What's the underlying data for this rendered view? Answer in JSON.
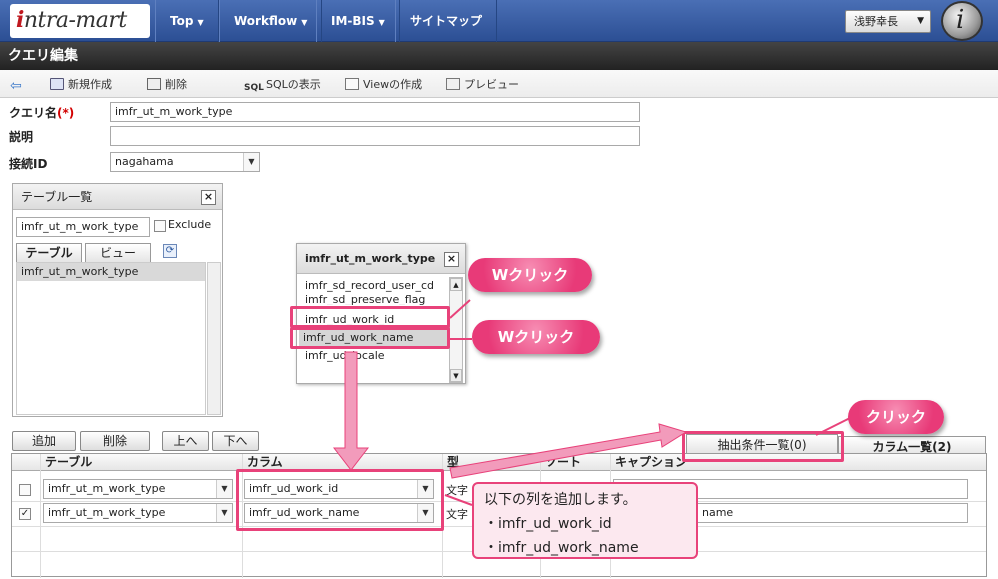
{
  "brand": {
    "logo_text": "intra-mart"
  },
  "nav": {
    "items": [
      {
        "label": "Top"
      },
      {
        "label": "Workflow"
      },
      {
        "label": "IM-BIS"
      },
      {
        "label": "サイトマップ"
      }
    ],
    "user": "浅野幸長"
  },
  "page": {
    "title": "クエリ編集"
  },
  "toolbar": {
    "new_label": "新規作成",
    "delete_label": "削除",
    "sql_prefix": "SQL",
    "sql_label": "SQLの表示",
    "view_label": "Viewの作成",
    "preview_label": "プレビュー"
  },
  "form": {
    "query_name_label": "クエリ名",
    "required_mark": "(*)",
    "query_name_value": "imfr_ut_m_work_type",
    "description_label": "説明",
    "description_value": "",
    "connection_label": "接続ID",
    "connection_value": "nagahama"
  },
  "table_list": {
    "title": "テーブル一覧",
    "filter_value": "imfr_ut_m_work_type",
    "exclude_label": "Exclude",
    "tab_table": "テーブル",
    "tab_view": "ビュー",
    "items": [
      "imfr_ut_m_work_type"
    ]
  },
  "column_popup": {
    "title": "imfr_ut_m_work_type",
    "items": [
      "imfr_sd_record_user_cd",
      "imfr_sd_preserve_flag",
      "imfr_ud_work_id",
      "imfr_ud_work_name",
      "imfr_ud_locale"
    ]
  },
  "buttons": {
    "add": "追加",
    "delete": "削除",
    "up": "上へ",
    "down": "下へ"
  },
  "result_tabs": {
    "condition": "抽出条件一覧(0)",
    "columns": "カラム一覧(2)"
  },
  "grid": {
    "headers": {
      "table": "テーブル",
      "column": "カラム",
      "type": "型",
      "sort": "ソート",
      "caption": "キャプション"
    },
    "rows": [
      {
        "checked": false,
        "check_mark": "",
        "table": "imfr_ut_m_work_type",
        "column": "imfr_ud_work_id",
        "type": "文字",
        "caption": ""
      },
      {
        "checked": true,
        "check_mark": "✓",
        "table": "imfr_ut_m_work_type",
        "column": "imfr_ud_work_name",
        "type": "文字",
        "caption": "name"
      }
    ]
  },
  "annotations": {
    "wclick_1": "Wクリック",
    "wclick_2": "Wクリック",
    "click": "クリック",
    "callout_line1": "以下の列を追加します。",
    "callout_line2": "・imfr_ud_work_id",
    "callout_line3": "・imfr_ud_work_name",
    "accent_color": "#e8427a"
  }
}
